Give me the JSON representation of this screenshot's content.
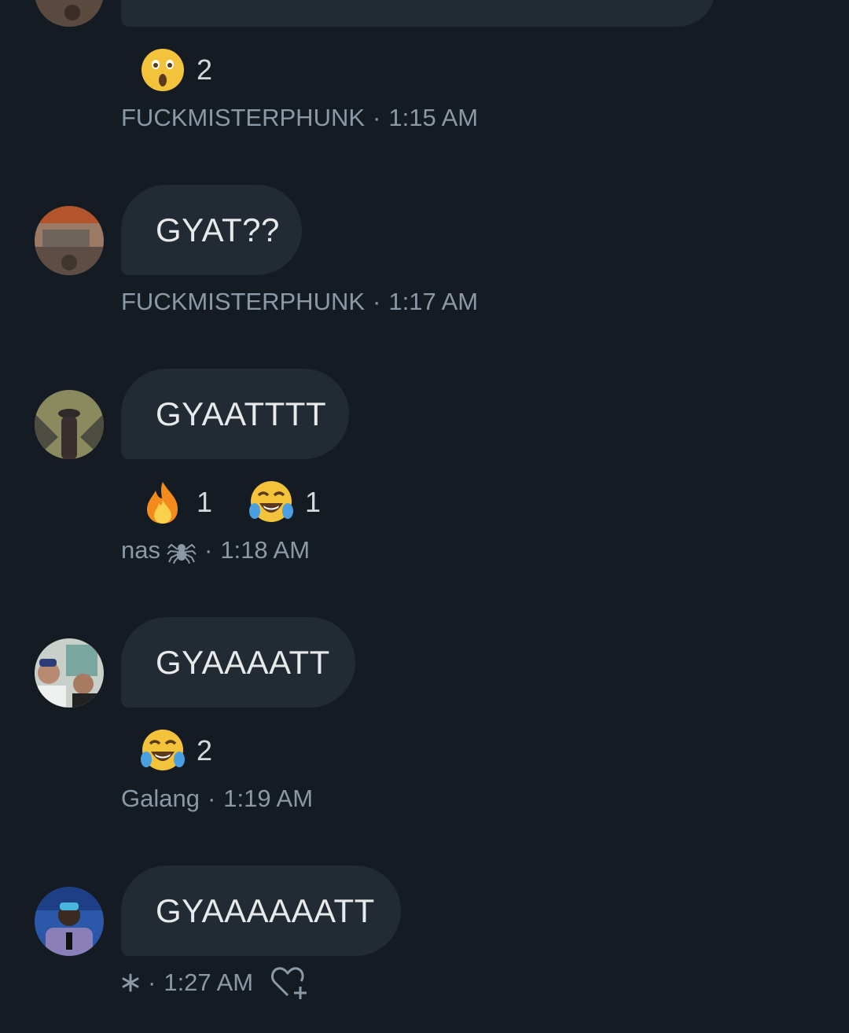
{
  "messages": [
    {
      "text": "",
      "reactions": [
        {
          "emoji_icon": "astonished-face-icon",
          "count": "2"
        }
      ],
      "sender": "FUCKMISTERPHUNK",
      "separator": "·",
      "time": "1:15 AM"
    },
    {
      "text": "GYAT??",
      "reactions": [],
      "sender": "FUCKMISTERPHUNK",
      "separator": "·",
      "time": "1:17 AM"
    },
    {
      "text": "GYAATTTT",
      "reactions": [
        {
          "emoji_icon": "fire-icon",
          "count": "1"
        },
        {
          "emoji_icon": "tears-of-joy-face-icon",
          "count": "1"
        }
      ],
      "sender": "nas",
      "sender_icon": "spider-icon",
      "separator": "·",
      "time": "1:18 AM"
    },
    {
      "text": "GYAAAATT",
      "reactions": [
        {
          "emoji_icon": "tears-of-joy-face-icon",
          "count": "2"
        }
      ],
      "sender": "Galang",
      "separator": "·",
      "time": "1:19 AM"
    },
    {
      "text": "GYAAAAAATT",
      "reactions": [],
      "sender_icon": "asterisk-icon",
      "separator": "·",
      "time": "1:27 AM",
      "action_icon": "add-reaction-heart-icon"
    }
  ],
  "colors": {
    "background": "#151b23",
    "bubble": "#222a33",
    "text": "#e7e9ea",
    "meta": "#8b98a5"
  }
}
